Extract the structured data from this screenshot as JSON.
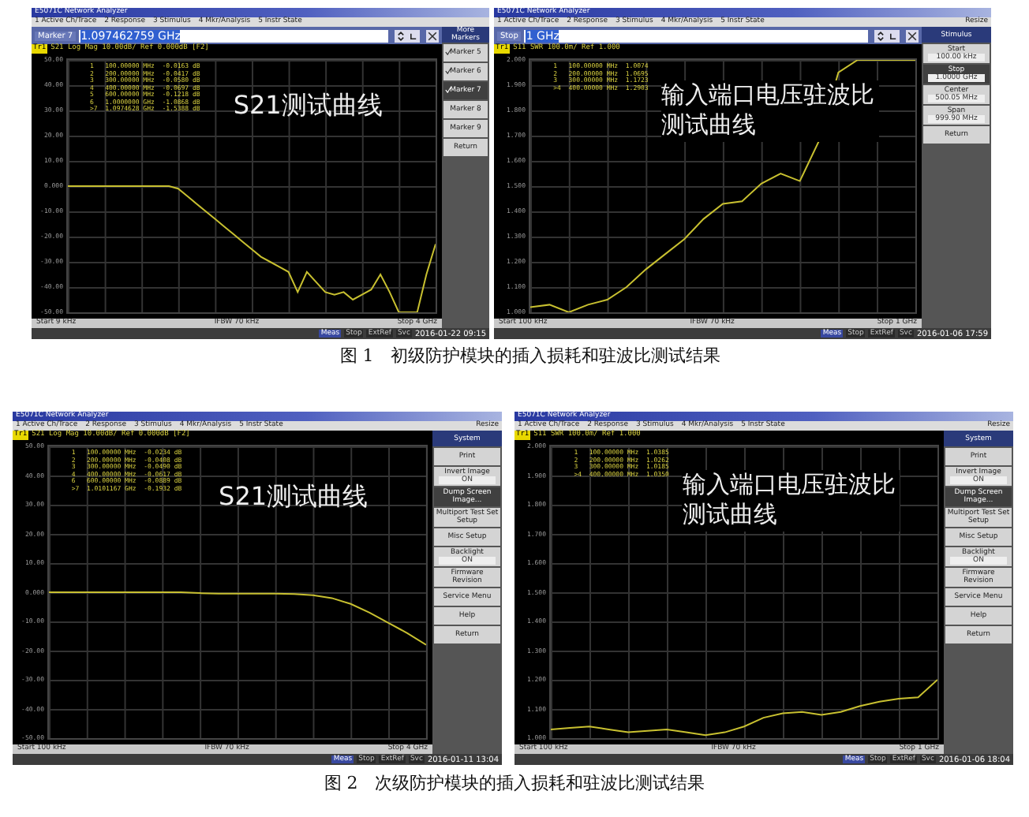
{
  "figures": [
    {
      "screens": [
        {
          "title": "E5071C Network Analyzer",
          "menu": [
            "1 Active Ch/Trace",
            "2 Response",
            "3 Stimulus",
            "4 Mkr/Analysis",
            "5 Instr State"
          ],
          "entry": {
            "label": "Marker 7",
            "value": "1.097462759 GHz"
          },
          "trace_label": "Tr1",
          "trace_header": "S21 Log Mag 10.00dB/ Ref 0.000dB [F2]",
          "markers": [
            "1   100.00000 MHz  -0.0163 dB",
            "2   200.00000 MHz  -0.0417 dB",
            "3   300.00000 MHz  -0.0580 dB",
            "4   400.00000 MHz  -0.0697 dB",
            "5   600.00000 MHz  -0.1218 dB",
            "6   1.0000000 GHz  -1.0868 dB",
            ">7  1.0974628 GHz  -1.5388 dB"
          ],
          "overlay": "S21测试曲线",
          "chart_data": {
            "type": "line",
            "categories": [
              null,
              null,
              null,
              null,
              null,
              null,
              null,
              null,
              null,
              null,
              null,
              null,
              null,
              null,
              null,
              null,
              null,
              null,
              null,
              null,
              null,
              null,
              null,
              null,
              null,
              null,
              null,
              null,
              null,
              null,
              null,
              null,
              null,
              null,
              null,
              null,
              null,
              null,
              null,
              null,
              null
            ],
            "series": [
              {
                "color": "#c8c030",
                "values": [
                  0,
                  0,
                  0,
                  0,
                  0,
                  0,
                  0,
                  0,
                  0,
                  0,
                  0,
                  0,
                  -1,
                  -4,
                  -7,
                  -10,
                  -13,
                  -16,
                  -19,
                  -22,
                  -25,
                  -28,
                  -30,
                  -32,
                  -34,
                  -42,
                  -34,
                  -38,
                  -42,
                  -43,
                  -42,
                  -45,
                  -43,
                  -41,
                  -35,
                  -42,
                  -50,
                  -50,
                  -50,
                  -35,
                  -23
                ]
              }
            ],
            "ylim": [
              -50,
              50
            ],
            "yticks": [
              {
                "value": 50,
                "label": "50.00"
              },
              {
                "value": 40,
                "label": "40.00"
              },
              {
                "value": 30,
                "label": "30.00"
              },
              {
                "value": 20,
                "label": "20.00"
              },
              {
                "value": 10,
                "label": "10.00"
              },
              {
                "value": 0,
                "label": "0.000"
              },
              {
                "value": -10,
                "label": "-10.00"
              },
              {
                "value": -20,
                "label": "-20.00"
              },
              {
                "value": -30,
                "label": "-30.00"
              },
              {
                "value": -40,
                "label": "-40.00"
              },
              {
                "value": -50,
                "label": "-50.00"
              }
            ]
          },
          "footer": {
            "start": "Start 9 kHz",
            "ifbw": "IFBW 70 kHz",
            "stop": "Stop 4 GHz"
          },
          "softkeys": {
            "title": "More Markers",
            "items": [
              {
                "label": "Marker 5",
                "selected": false,
                "checked": true
              },
              {
                "label": "Marker 6",
                "selected": false,
                "checked": true
              },
              {
                "label": "Marker 7",
                "selected": true,
                "checked": true
              },
              {
                "label": "Marker 8",
                "selected": false,
                "checked": false
              },
              {
                "label": "Marker 9",
                "selected": false,
                "checked": false
              },
              {
                "label": "Return",
                "selected": false,
                "checked": false
              }
            ]
          },
          "status": [
            {
              "text": "Meas",
              "active": true
            },
            {
              "text": "Stop",
              "active": false
            },
            {
              "text": "ExtRef",
              "active": false
            },
            {
              "text": "Svc",
              "active": false
            }
          ],
          "timestamp": "2016-01-22 09:15"
        },
        {
          "title": "E5071C Network Analyzer",
          "menu": [
            "1 Active Ch/Trace",
            "2 Response",
            "3 Stimulus",
            "4 Mkr/Analysis",
            "5 Instr State"
          ],
          "resize": "Resize",
          "entry": {
            "label": "Stop",
            "value": "1 GHz"
          },
          "trace_label": "Tr1",
          "trace_header": "S11 SWR 100.0m/ Ref 1.000",
          "markers": [
            "1   100.00000 MHz  1.0074",
            "2   200.00000 MHz  1.0695",
            "3   300.00000 MHz  1.1723",
            ">4  400.00000 MHz  1.2903"
          ],
          "overlay": "输入端口电压驻波比测试曲线",
          "chart_data": {
            "type": "line",
            "categories": [
              null,
              null,
              null,
              null,
              null,
              null,
              null,
              null,
              null,
              null,
              null,
              null,
              null,
              null,
              null,
              null,
              null,
              null,
              null,
              null,
              null
            ],
            "series": [
              {
                "color": "#c8c030",
                "values": [
                  1.02,
                  1.03,
                  1.0,
                  1.03,
                  1.05,
                  1.1,
                  1.17,
                  1.23,
                  1.29,
                  1.37,
                  1.43,
                  1.44,
                  1.51,
                  1.55,
                  1.52,
                  1.68,
                  1.95,
                  2.0,
                  2.0,
                  2.0,
                  2.0
                ]
              }
            ],
            "ylim": [
              1,
              2
            ],
            "yticks": [
              {
                "value": 2,
                "label": "2.000"
              },
              {
                "value": 1.9,
                "label": "1.900"
              },
              {
                "value": 1.8,
                "label": "1.800"
              },
              {
                "value": 1.7,
                "label": "1.700"
              },
              {
                "value": 1.6,
                "label": "1.600"
              },
              {
                "value": 1.5,
                "label": "1.500"
              },
              {
                "value": 1.4,
                "label": "1.400"
              },
              {
                "value": 1.3,
                "label": "1.300"
              },
              {
                "value": 1.2,
                "label": "1.200"
              },
              {
                "value": 1.1,
                "label": "1.100"
              },
              {
                "value": 1,
                "label": "1.000"
              }
            ]
          },
          "footer": {
            "start": "Start 100 kHz",
            "ifbw": "IFBW 70 kHz",
            "stop": "Stop 1 GHz"
          },
          "softkeys": {
            "title": "Stimulus",
            "items": [
              {
                "label": "Start",
                "value": "100.00 kHz",
                "selected": false
              },
              {
                "label": "Stop",
                "value": "1.0000 GHz",
                "selected": true
              },
              {
                "label": "Center",
                "value": "500.05 MHz",
                "selected": false
              },
              {
                "label": "Span",
                "value": "999.90 MHz",
                "selected": false
              },
              {
                "label": "Return",
                "selected": false
              }
            ]
          },
          "status": [
            {
              "text": "Meas",
              "active": true
            },
            {
              "text": "Stop",
              "active": false
            },
            {
              "text": "ExtRef",
              "active": false
            },
            {
              "text": "Svc",
              "active": false
            }
          ],
          "timestamp": "2016-01-06 17:59"
        }
      ],
      "caption": "图 1　初级防护模块的插入损耗和驻波比测试结果"
    },
    {
      "screens": [
        {
          "title": "E5071C Network Analyzer",
          "menu": [
            "1 Active Ch/Trace",
            "2 Response",
            "3 Stimulus",
            "4 Mkr/Analysis",
            "5 Instr State"
          ],
          "resize": "Resize",
          "trace_label": "Tr1",
          "trace_header": "S21 Log Mag 10.00dB/ Ref 0.000dB [F2]",
          "markers": [
            "1   100.00000 MHz  -0.0234 dB",
            "2   200.00000 MHz  -0.0408 dB",
            "3   300.00000 MHz  -0.0490 dB",
            "4   400.00000 MHz  -0.0617 dB",
            "6   600.00000 MHz  -0.0889 dB",
            ">7  1.0101167 GHz  -0.1932 dB"
          ],
          "overlay": "S21测试曲线",
          "chart_data": {
            "type": "line",
            "categories": [
              null,
              null,
              null,
              null,
              null,
              null,
              null,
              null,
              null,
              null,
              null,
              null,
              null,
              null,
              null,
              null,
              null,
              null,
              null,
              null,
              null
            ],
            "series": [
              {
                "color": "#c8c030",
                "values": [
                  0,
                  0,
                  0,
                  0,
                  0,
                  0,
                  0,
                  0,
                  -0.3,
                  -0.5,
                  -0.5,
                  -0.5,
                  -0.5,
                  -0.6,
                  -1,
                  -2,
                  -4,
                  -7,
                  -10.5,
                  -14,
                  -18
                ]
              }
            ],
            "ylim": [
              -50,
              50
            ],
            "yticks": [
              {
                "value": 50,
                "label": "50.00"
              },
              {
                "value": 40,
                "label": "40.00"
              },
              {
                "value": 30,
                "label": "30.00"
              },
              {
                "value": 20,
                "label": "20.00"
              },
              {
                "value": 10,
                "label": "10.00"
              },
              {
                "value": 0,
                "label": "0.000"
              },
              {
                "value": -10,
                "label": "-10.00"
              },
              {
                "value": -20,
                "label": "-20.00"
              },
              {
                "value": -30,
                "label": "-30.00"
              },
              {
                "value": -40,
                "label": "-40.00"
              },
              {
                "value": -50,
                "label": "-50.00"
              }
            ]
          },
          "footer": {
            "start": "Start 100 kHz",
            "ifbw": "IFBW 70 kHz",
            "stop": "Stop 4 GHz"
          },
          "softkeys": {
            "title": "System",
            "items": [
              {
                "label": "Print",
                "selected": false
              },
              {
                "label": "Invert Image",
                "value": "ON",
                "selected": false
              },
              {
                "label": "Dump Screen Image...",
                "selected": true
              },
              {
                "label": "Multiport Test Set Setup",
                "selected": false
              },
              {
                "label": "Misc Setup",
                "selected": false
              },
              {
                "label": "Backlight",
                "value": "ON",
                "selected": false
              },
              {
                "label": "Firmware Revision",
                "selected": false
              },
              {
                "label": "Service Menu",
                "selected": false
              },
              {
                "label": "Help",
                "selected": false
              },
              {
                "label": "Return",
                "selected": false
              }
            ]
          },
          "status": [
            {
              "text": "Meas",
              "active": true
            },
            {
              "text": "Stop",
              "active": false
            },
            {
              "text": "ExtRef",
              "active": false
            },
            {
              "text": "Svc",
              "active": false
            }
          ],
          "timestamp": "2016-01-11 13:04"
        },
        {
          "title": "E5071C Network Analyzer",
          "menu": [
            "1 Active Ch/Trace",
            "2 Response",
            "3 Stimulus",
            "4 Mkr/Analysis",
            "5 Instr State"
          ],
          "resize": "Resize",
          "trace_label": "Tr1",
          "trace_header": "S11 SWR 100.0m/ Ref 1.000",
          "markers": [
            "1   100.00000 MHz  1.0385",
            "2   200.00000 MHz  1.0262",
            "3   300.00000 MHz  1.0185",
            ">4  400.00000 MHz  1.0350"
          ],
          "overlay": "输入端口电压驻波比测试曲线",
          "chart_data": {
            "type": "line",
            "categories": [
              null,
              null,
              null,
              null,
              null,
              null,
              null,
              null,
              null,
              null,
              null,
              null,
              null,
              null,
              null,
              null,
              null,
              null,
              null,
              null,
              null
            ],
            "series": [
              {
                "color": "#c8c030",
                "values": [
                  1.03,
                  1.035,
                  1.04,
                  1.03,
                  1.02,
                  1.025,
                  1.03,
                  1.02,
                  1.01,
                  1.02,
                  1.04,
                  1.07,
                  1.085,
                  1.09,
                  1.08,
                  1.09,
                  1.11,
                  1.125,
                  1.135,
                  1.14,
                  1.2
                ]
              }
            ],
            "ylim": [
              1,
              2
            ],
            "yticks": [
              {
                "value": 2,
                "label": "2.000"
              },
              {
                "value": 1.9,
                "label": "1.900"
              },
              {
                "value": 1.8,
                "label": "1.800"
              },
              {
                "value": 1.7,
                "label": "1.700"
              },
              {
                "value": 1.6,
                "label": "1.600"
              },
              {
                "value": 1.5,
                "label": "1.500"
              },
              {
                "value": 1.4,
                "label": "1.400"
              },
              {
                "value": 1.3,
                "label": "1.300"
              },
              {
                "value": 1.2,
                "label": "1.200"
              },
              {
                "value": 1.1,
                "label": "1.100"
              },
              {
                "value": 1,
                "label": "1.000"
              }
            ]
          },
          "footer": {
            "start": "Start 100 kHz",
            "ifbw": "IFBW 70 kHz",
            "stop": "Stop 1 GHz"
          },
          "softkeys": {
            "title": "System",
            "items": [
              {
                "label": "Print",
                "selected": false
              },
              {
                "label": "Invert Image",
                "value": "ON",
                "selected": false
              },
              {
                "label": "Dump Screen Image...",
                "selected": true
              },
              {
                "label": "Multiport Test Set Setup",
                "selected": false
              },
              {
                "label": "Misc Setup",
                "selected": false
              },
              {
                "label": "Backlight",
                "value": "ON",
                "selected": false
              },
              {
                "label": "Firmware Revision",
                "selected": false
              },
              {
                "label": "Service Menu",
                "selected": false
              },
              {
                "label": "Help",
                "selected": false
              },
              {
                "label": "Return",
                "selected": false
              }
            ]
          },
          "status": [
            {
              "text": "Meas",
              "active": true
            },
            {
              "text": "Stop",
              "active": false
            },
            {
              "text": "ExtRef",
              "active": false
            },
            {
              "text": "Svc",
              "active": false
            }
          ],
          "timestamp": "2016-01-06 18:04"
        }
      ],
      "caption": "图 2　次级防护模块的插入损耗和驻波比测试结果"
    }
  ]
}
